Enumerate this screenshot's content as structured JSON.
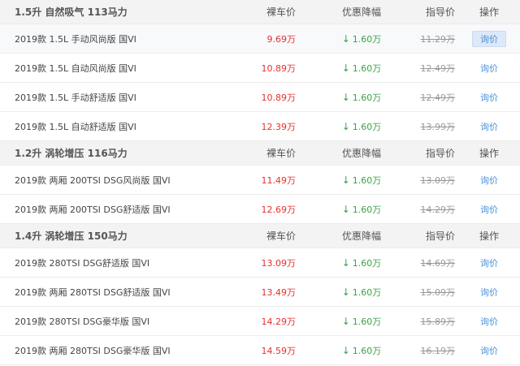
{
  "header_labels": {
    "dealer_price": "裸车价",
    "discount": "优惠降幅",
    "guide_price": "指导价",
    "action": "操作"
  },
  "groups": [
    {
      "title": "1.5升 自然吸气 113马力",
      "items": [
        {
          "name": "2019款 1.5L 手动风尚版 国VI",
          "dealer_price": "9.69万",
          "discount": "1.60万",
          "guide_price": "11.29万",
          "action": "询价",
          "highlighted": true
        },
        {
          "name": "2019款 1.5L 自动风尚版 国VI",
          "dealer_price": "10.89万",
          "discount": "1.60万",
          "guide_price": "12.49万",
          "action": "询价"
        },
        {
          "name": "2019款 1.5L 手动舒适版 国VI",
          "dealer_price": "10.89万",
          "discount": "1.60万",
          "guide_price": "12.49万",
          "action": "询价"
        },
        {
          "name": "2019款 1.5L 自动舒适版 国VI",
          "dealer_price": "12.39万",
          "discount": "1.60万",
          "guide_price": "13.99万",
          "action": "询价"
        }
      ]
    },
    {
      "title": "1.2升 涡轮增压 116马力",
      "items": [
        {
          "name": "2019款 两厢 200TSI DSG风尚版 国VI",
          "dealer_price": "11.49万",
          "discount": "1.60万",
          "guide_price": "13.09万",
          "action": "询价"
        },
        {
          "name": "2019款 两厢 200TSI DSG舒适版 国VI",
          "dealer_price": "12.69万",
          "discount": "1.60万",
          "guide_price": "14.29万",
          "action": "询价"
        }
      ]
    },
    {
      "title": "1.4升 涡轮增压 150马力",
      "items": [
        {
          "name": "2019款 280TSI DSG舒适版 国VI",
          "dealer_price": "13.09万",
          "discount": "1.60万",
          "guide_price": "14.69万",
          "action": "询价"
        },
        {
          "name": "2019款 两厢 280TSI DSG舒适版 国VI",
          "dealer_price": "13.49万",
          "discount": "1.60万",
          "guide_price": "15.09万",
          "action": "询价"
        },
        {
          "name": "2019款 280TSI DSG豪华版 国VI",
          "dealer_price": "14.29万",
          "discount": "1.60万",
          "guide_price": "15.89万",
          "action": "询价"
        },
        {
          "name": "2019款 两厢 280TSI DSG豪华版 国VI",
          "dealer_price": "14.59万",
          "discount": "1.60万",
          "guide_price": "16.19万",
          "action": "询价"
        }
      ]
    }
  ],
  "icons": {
    "discount_arrow": "arrow-down-icon"
  },
  "colors": {
    "dealer_price": "#e5302f",
    "discount": "#3aa145",
    "guide_price": "#999999",
    "action": "#4a90d9",
    "header_bg": "#f3f3f3"
  }
}
